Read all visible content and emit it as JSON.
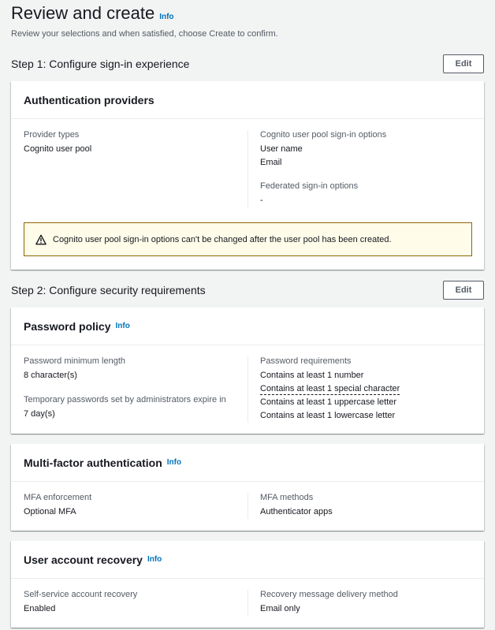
{
  "header": {
    "title": "Review and create",
    "info": "Info",
    "description": "Review your selections and when satisfied, choose Create to confirm."
  },
  "step1": {
    "title": "Step 1: Configure sign-in experience",
    "edit_label": "Edit",
    "auth_providers": {
      "title": "Authentication providers",
      "provider_types_label": "Provider types",
      "provider_types_value": "Cognito user pool",
      "signin_options_label": "Cognito user pool sign-in options",
      "signin_options_values": [
        "User name",
        "Email"
      ],
      "federated_label": "Federated sign-in options",
      "federated_value": "-",
      "alert_text": "Cognito user pool sign-in options can't be changed after the user pool has been created."
    }
  },
  "step2": {
    "title": "Step 2: Configure security requirements",
    "edit_label": "Edit",
    "password_policy": {
      "title": "Password policy",
      "info": "Info",
      "min_length_label": "Password minimum length",
      "min_length_value": "8 character(s)",
      "temp_expire_label": "Temporary passwords set by administrators expire in",
      "temp_expire_value": "7 day(s)",
      "requirements_label": "Password requirements",
      "requirements": [
        "Contains at least 1 number",
        "Contains at least 1 special character",
        "Contains at least 1 uppercase letter",
        "Contains at least 1 lowercase letter"
      ]
    },
    "mfa": {
      "title": "Multi-factor authentication",
      "info": "Info",
      "enforcement_label": "MFA enforcement",
      "enforcement_value": "Optional MFA",
      "methods_label": "MFA methods",
      "methods_value": "Authenticator apps"
    },
    "recovery": {
      "title": "User account recovery",
      "info": "Info",
      "self_service_label": "Self-service account recovery",
      "self_service_value": "Enabled",
      "delivery_label": "Recovery message delivery method",
      "delivery_value": "Email only"
    }
  },
  "colors": {
    "accent_link": "#0073bb",
    "warning_border": "#8d6605",
    "warning_bg": "#fffce9"
  }
}
